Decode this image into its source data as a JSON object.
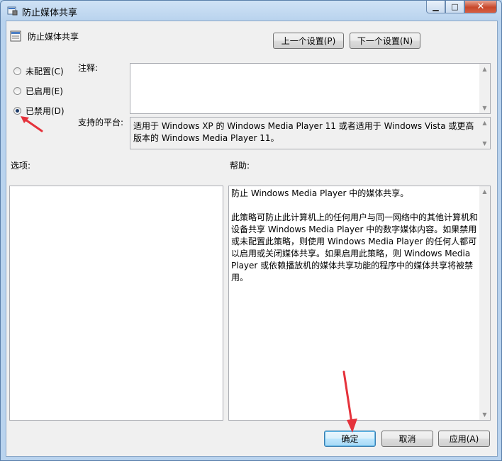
{
  "window": {
    "title": "防止媒体共享"
  },
  "header": {
    "policy_name": "防止媒体共享",
    "prev_button": "上一个设置(P)",
    "next_button": "下一个设置(N)"
  },
  "options": {
    "not_configured": "未配置(C)",
    "enabled": "已启用(E)",
    "disabled": "已禁用(D)",
    "selected": "disabled"
  },
  "comment": {
    "label": "注释:",
    "value": ""
  },
  "platform": {
    "label": "支持的平台:",
    "value": "适用于 Windows XP 的 Windows Media Player 11 或者适用于 Windows Vista 或更高版本的 Windows Media Player 11。"
  },
  "sections": {
    "options_label": "选项:",
    "help_label": "帮助:"
  },
  "help": {
    "text": "防止 Windows Media Player 中的媒体共享。\n\n此策略可防止此计算机上的任何用户与同一网络中的其他计算机和设备共享 Windows Media Player 中的数字媒体内容。如果禁用或未配置此策略，则使用 Windows Media Player 的任何人都可以启用或关闭媒体共享。如果启用此策略，则 Windows Media Player 或依赖播放机的媒体共享功能的程序中的媒体共享将被禁用。"
  },
  "footer": {
    "ok": "确定",
    "cancel": "取消",
    "apply": "应用(A)"
  },
  "colors": {
    "annotation_arrow": "#e5323b"
  }
}
